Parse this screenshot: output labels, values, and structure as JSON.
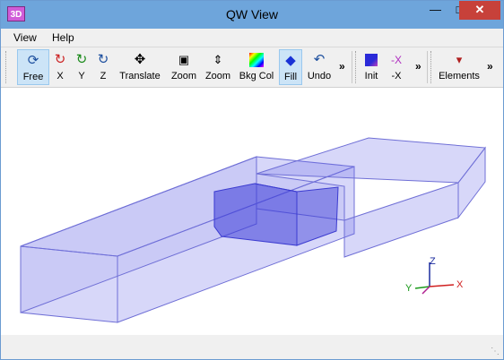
{
  "window": {
    "title": "QW View",
    "app_icon_text": "3D"
  },
  "menu": [
    "View",
    "Help"
  ],
  "toolbar": {
    "buttons": [
      {
        "id": "free",
        "label": "Free",
        "icon": "rotate-free-icon",
        "active": true
      },
      {
        "id": "x",
        "label": "X",
        "icon": "rotate-x-icon"
      },
      {
        "id": "y",
        "label": "Y",
        "icon": "rotate-y-icon"
      },
      {
        "id": "z",
        "label": "Z",
        "icon": "rotate-z-icon"
      },
      {
        "id": "translate",
        "label": "Translate",
        "icon": "move-arrows-icon"
      },
      {
        "id": "zoom1",
        "label": "Zoom",
        "icon": "zoom-box-icon"
      },
      {
        "id": "zoom2",
        "label": "Zoom",
        "icon": "zoom-updown-icon"
      },
      {
        "id": "bkgcol",
        "label": "Bkg Col",
        "icon": "color-palette-icon"
      },
      {
        "id": "fill",
        "label": "Fill",
        "icon": "diamond-fill-icon",
        "active": true
      },
      {
        "id": "undo",
        "label": "Undo",
        "icon": "undo-icon"
      },
      {
        "id": "init",
        "label": "Init",
        "icon": "cube-icon"
      },
      {
        "id": "negx",
        "label": "-X",
        "icon": "neg-x-axis-icon"
      },
      {
        "id": "elements",
        "label": "Elements",
        "icon": "elements-icon"
      }
    ],
    "overflow_label": "»"
  },
  "axes": {
    "x": "X",
    "y": "Y",
    "z": "Z"
  },
  "colors": {
    "titlebar": "#6ea5db",
    "close": "#c7413a",
    "fill": "#6b6be6"
  }
}
